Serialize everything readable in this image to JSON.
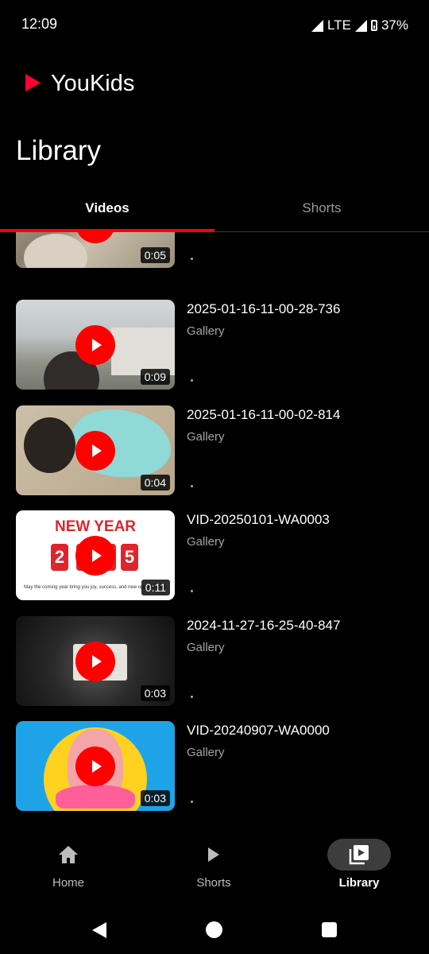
{
  "status_bar": {
    "time": "12:09",
    "network": "LTE",
    "battery": "37%"
  },
  "app": {
    "name": "YouKids",
    "accent_color": "#ff0000",
    "logo_icon": "play-triangle-icon"
  },
  "page": {
    "title": "Library"
  },
  "tabs": [
    {
      "label": "Videos",
      "active": true
    },
    {
      "label": "Shorts",
      "active": false
    }
  ],
  "videos": [
    {
      "title": "",
      "source": "",
      "duration": "0:05"
    },
    {
      "title": "2025-01-16-11-00-28-736",
      "source": "Gallery",
      "duration": "0:09"
    },
    {
      "title": "2025-01-16-11-00-02-814",
      "source": "Gallery",
      "duration": "0:04"
    },
    {
      "title": "VID-20250101-WA0003",
      "source": "Gallery",
      "duration": "0:11"
    },
    {
      "title": "2024-11-27-16-25-40-847",
      "source": "Gallery",
      "duration": "0:03"
    },
    {
      "title": "VID-20240907-WA0000",
      "source": "Gallery",
      "duration": "0:03"
    }
  ],
  "thumbnail_text": {
    "new_year_heading": "NEW YEAR",
    "new_year_digits": [
      "2",
      "0",
      "2",
      "5"
    ],
    "new_year_caption": "May the coming year bring you joy, success, and new opportunities."
  },
  "bottom_nav": [
    {
      "label": "Home",
      "icon": "home-icon",
      "active": false
    },
    {
      "label": "Shorts",
      "icon": "play-icon",
      "active": false
    },
    {
      "label": "Library",
      "icon": "video-library-icon",
      "active": true
    }
  ]
}
